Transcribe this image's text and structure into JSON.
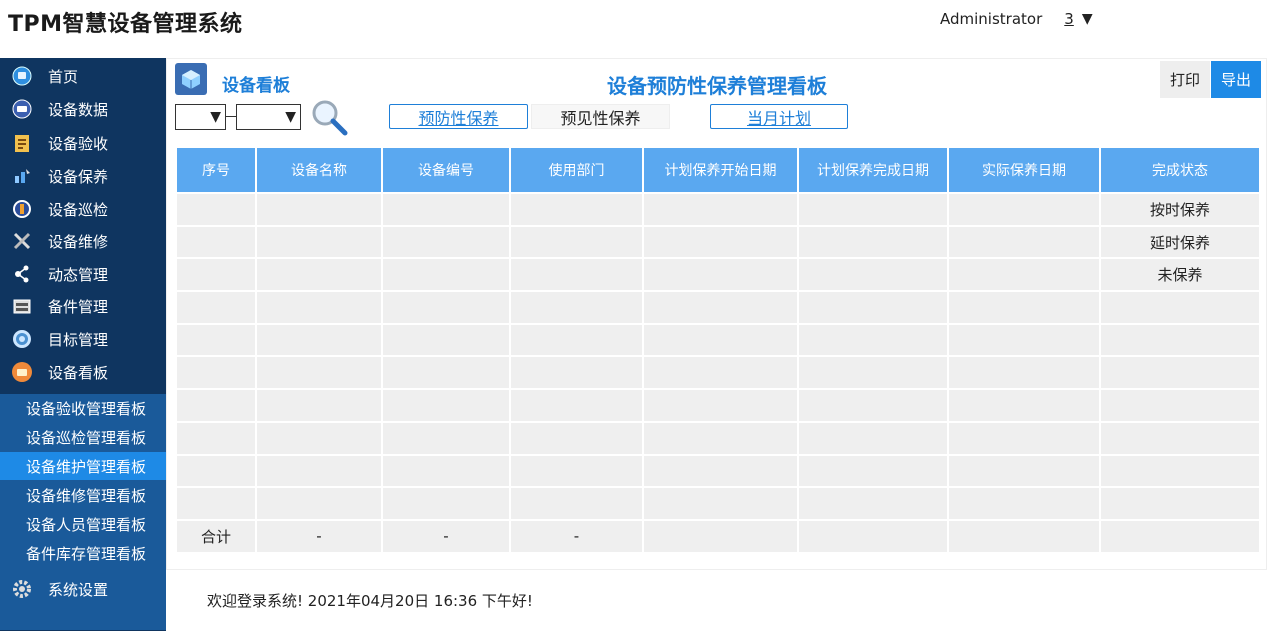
{
  "app": {
    "title": "TPM智慧设备管理系统"
  },
  "user": {
    "name": "Administrator",
    "notifications": "3",
    "caret": "▼"
  },
  "sidebar": {
    "items": [
      {
        "label": "首页",
        "icon": "home-icon"
      },
      {
        "label": "设备数据",
        "icon": "data-icon"
      },
      {
        "label": "设备验收",
        "icon": "clipboard-icon"
      },
      {
        "label": "设备保养",
        "icon": "maintenance-icon"
      },
      {
        "label": "设备巡检",
        "icon": "inspection-icon"
      },
      {
        "label": "设备维修",
        "icon": "tools-icon"
      },
      {
        "label": "动态管理",
        "icon": "share-icon"
      },
      {
        "label": "备件管理",
        "icon": "parts-icon"
      },
      {
        "label": "目标管理",
        "icon": "target-icon"
      },
      {
        "label": "设备看板",
        "icon": "dashboard-icon"
      }
    ],
    "subitems": [
      {
        "label": "设备验收管理看板"
      },
      {
        "label": "设备巡检管理看板"
      },
      {
        "label": "设备维护管理看板"
      },
      {
        "label": "设备维修管理看板"
      },
      {
        "label": "设备人员管理看板"
      },
      {
        "label": "备件库存管理看板"
      }
    ],
    "settings": {
      "label": "系统设置",
      "icon": "gear-icon"
    }
  },
  "board": {
    "label": "设备看板",
    "title": "设备预防性保养管理看板",
    "print_label": "打印",
    "export_label": "导出",
    "dropdown_caret": "▼",
    "tabs": {
      "preventive": "预防性保养",
      "predictive": "预见性保养",
      "month_plan": "当月计划"
    }
  },
  "table": {
    "headers": [
      "序号",
      "设备名称",
      "设备编号",
      "使用部门",
      "计划保养开始日期",
      "计划保养完成日期",
      "实际保养日期",
      "完成状态"
    ],
    "rows": [
      [
        "",
        "",
        "",
        "",
        "",
        "",
        "",
        "按时保养"
      ],
      [
        "",
        "",
        "",
        "",
        "",
        "",
        "",
        "延时保养"
      ],
      [
        "",
        "",
        "",
        "",
        "",
        "",
        "",
        "未保养"
      ],
      [
        "",
        "",
        "",
        "",
        "",
        "",
        "",
        ""
      ],
      [
        "",
        "",
        "",
        "",
        "",
        "",
        "",
        ""
      ],
      [
        "",
        "",
        "",
        "",
        "",
        "",
        "",
        ""
      ],
      [
        "",
        "",
        "",
        "",
        "",
        "",
        "",
        ""
      ],
      [
        "",
        "",
        "",
        "",
        "",
        "",
        "",
        ""
      ],
      [
        "",
        "",
        "",
        "",
        "",
        "",
        "",
        ""
      ],
      [
        "",
        "",
        "",
        "",
        "",
        "",
        "",
        ""
      ]
    ],
    "total_row": [
      "合计",
      "-",
      "-",
      "-",
      "",
      "",
      "",
      ""
    ]
  },
  "footer": {
    "text": "欢迎登录系统!  2021年04月20日 16:36 下午好!"
  },
  "colors": {
    "sidebar_bg": "#0f3560",
    "submenu_bg": "#1a5a9a",
    "accent": "#1e8ae6",
    "header_blue": "#5aa8f0",
    "title_blue": "#1e7fd8"
  }
}
